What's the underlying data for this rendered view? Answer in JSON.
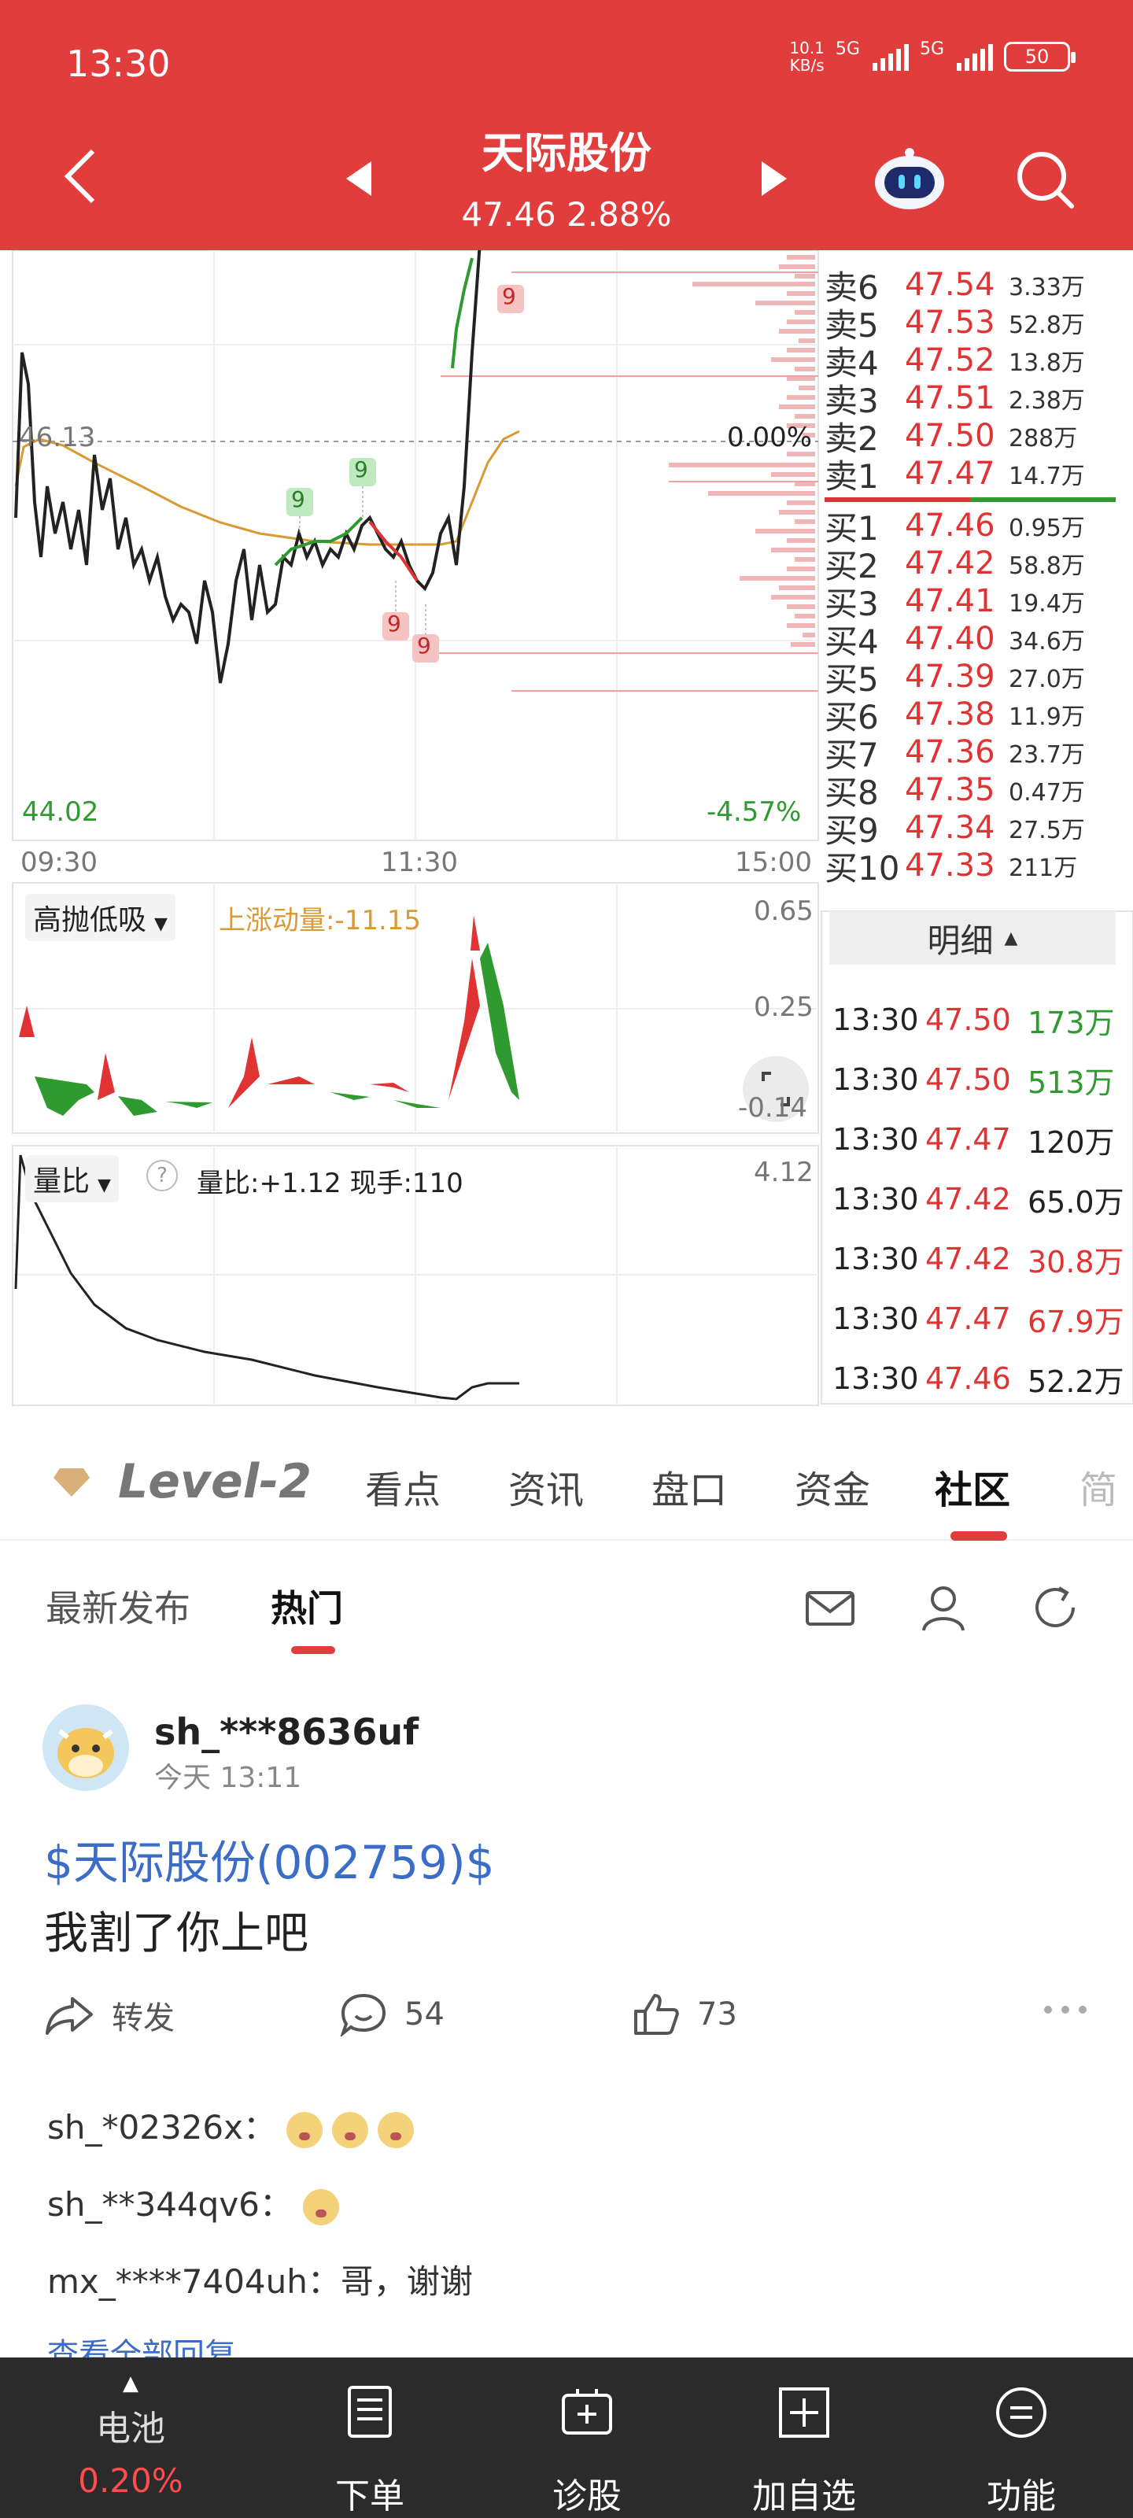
{
  "status_bar": {
    "time": "13:30",
    "speed_value": "10.1",
    "speed_unit": "KB/s",
    "sim1": "5G",
    "sim2": "5G",
    "battery": "50"
  },
  "header": {
    "title": "天际股份",
    "price_line": "47.46 2.88%"
  },
  "chart": {
    "high_price": "46.13",
    "zero_pct": "0.00%",
    "low_price": "44.02",
    "low_pct": "-4.57%",
    "times": [
      "09:30",
      "11:30",
      "15:00"
    ],
    "markers": [
      "9",
      "9",
      "9",
      "9",
      "9"
    ]
  },
  "order_book": {
    "asks": [
      {
        "label": "卖6",
        "price": "47.54",
        "vol": "3.33万"
      },
      {
        "label": "卖5",
        "price": "47.53",
        "vol": "52.8万"
      },
      {
        "label": "卖4",
        "price": "47.52",
        "vol": "13.8万"
      },
      {
        "label": "卖3",
        "price": "47.51",
        "vol": "2.38万"
      },
      {
        "label": "卖2",
        "price": "47.50",
        "vol": "288万"
      },
      {
        "label": "卖1",
        "price": "47.47",
        "vol": "14.7万"
      }
    ],
    "bids": [
      {
        "label": "买1",
        "price": "47.46",
        "vol": "0.95万"
      },
      {
        "label": "买2",
        "price": "47.42",
        "vol": "58.8万"
      },
      {
        "label": "买3",
        "price": "47.41",
        "vol": "19.4万"
      },
      {
        "label": "买4",
        "price": "47.40",
        "vol": "34.6万"
      },
      {
        "label": "买5",
        "price": "47.39",
        "vol": "27.0万"
      },
      {
        "label": "买6",
        "price": "47.38",
        "vol": "11.9万"
      },
      {
        "label": "买7",
        "price": "47.36",
        "vol": "23.7万"
      },
      {
        "label": "买8",
        "price": "47.35",
        "vol": "0.47万"
      },
      {
        "label": "买9",
        "price": "47.34",
        "vol": "27.5万"
      },
      {
        "label": "买10",
        "price": "47.33",
        "vol": "211万"
      }
    ]
  },
  "detail": {
    "label": "明细"
  },
  "trades": [
    {
      "time": "13:30",
      "price": "47.50",
      "vol": "173万",
      "color": "#2f9a2f"
    },
    {
      "time": "13:30",
      "price": "47.50",
      "vol": "513万",
      "color": "#2f9a2f"
    },
    {
      "time": "13:30",
      "price": "47.47",
      "vol": "120万",
      "color": "#222222"
    },
    {
      "time": "13:30",
      "price": "47.42",
      "vol": "65.0万",
      "color": "#222222"
    },
    {
      "time": "13:30",
      "price": "47.42",
      "vol": "30.8万",
      "color": "#e03434"
    },
    {
      "time": "13:30",
      "price": "47.47",
      "vol": "67.9万",
      "color": "#e03434"
    },
    {
      "time": "13:30",
      "price": "47.46",
      "vol": "52.2万",
      "color": "#222222"
    }
  ],
  "indicator1": {
    "name": "高抛低吸",
    "value_label": "上涨动量:-11.15",
    "top": "0.65",
    "mid": "0.25",
    "low": "-0.14"
  },
  "indicator2": {
    "name": "量比",
    "info": "量比:+1.12  现手:110",
    "top": "4.12"
  },
  "tabs": {
    "level2": "Level-2",
    "items": [
      "看点",
      "资讯",
      "盘口",
      "资金",
      "社区",
      "简"
    ]
  },
  "community": {
    "latest": "最新发布",
    "hot": "热门"
  },
  "post": {
    "author": "sh_***8636uf",
    "time": "今天 13:11",
    "stock": "$天际股份(002759)$",
    "text": "我割了你上吧",
    "share": "转发",
    "comments": "54",
    "likes": "73",
    "replies": [
      {
        "user": "sh_*02326x：",
        "text": ""
      },
      {
        "user": "sh_**344qv6：",
        "text": ""
      },
      {
        "user": "mx_****7404uh：",
        "text": "哥，谢谢"
      }
    ],
    "view_all": "查看全部回复"
  },
  "bottom_bar": {
    "battery_label": "电池",
    "battery_value": "0.20%",
    "items": [
      "下单",
      "诊股",
      "加自选",
      "功能"
    ]
  }
}
